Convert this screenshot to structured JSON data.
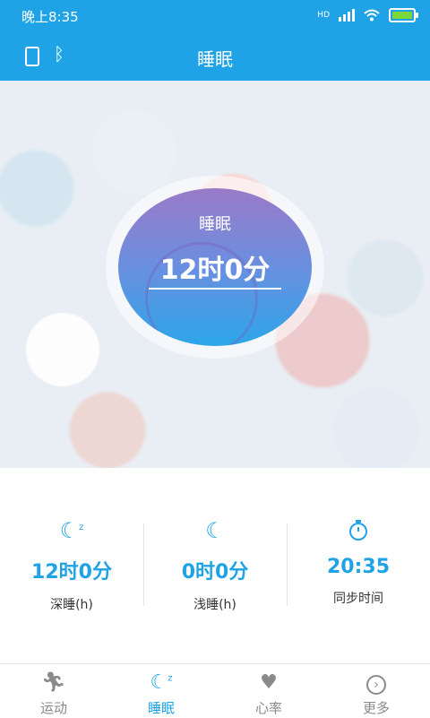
{
  "statusbar": {
    "time": "晚上8:35",
    "signal_label": "HD"
  },
  "appbar": {
    "title": "睡眠"
  },
  "sleep_circle": {
    "label": "睡眠",
    "value": "12时0分"
  },
  "stats": [
    {
      "icon": "moon-zz-icon",
      "value": "12时0分",
      "caption": "深睡(h)"
    },
    {
      "icon": "moon-icon",
      "value": "0时0分",
      "caption": "浅睡(h)"
    },
    {
      "icon": "stopwatch-icon",
      "value": "20:35",
      "caption": "同步时间"
    }
  ],
  "tabs": [
    {
      "icon": "runner-icon",
      "label": "运动"
    },
    {
      "icon": "moon-zz-icon",
      "label": "睡眠"
    },
    {
      "icon": "heart-pulse-icon",
      "label": "心率"
    },
    {
      "icon": "chevron-circle-icon",
      "label": "更多"
    }
  ],
  "colors": {
    "accent": "#1fa3e6",
    "inactive": "#8a8a8a"
  }
}
